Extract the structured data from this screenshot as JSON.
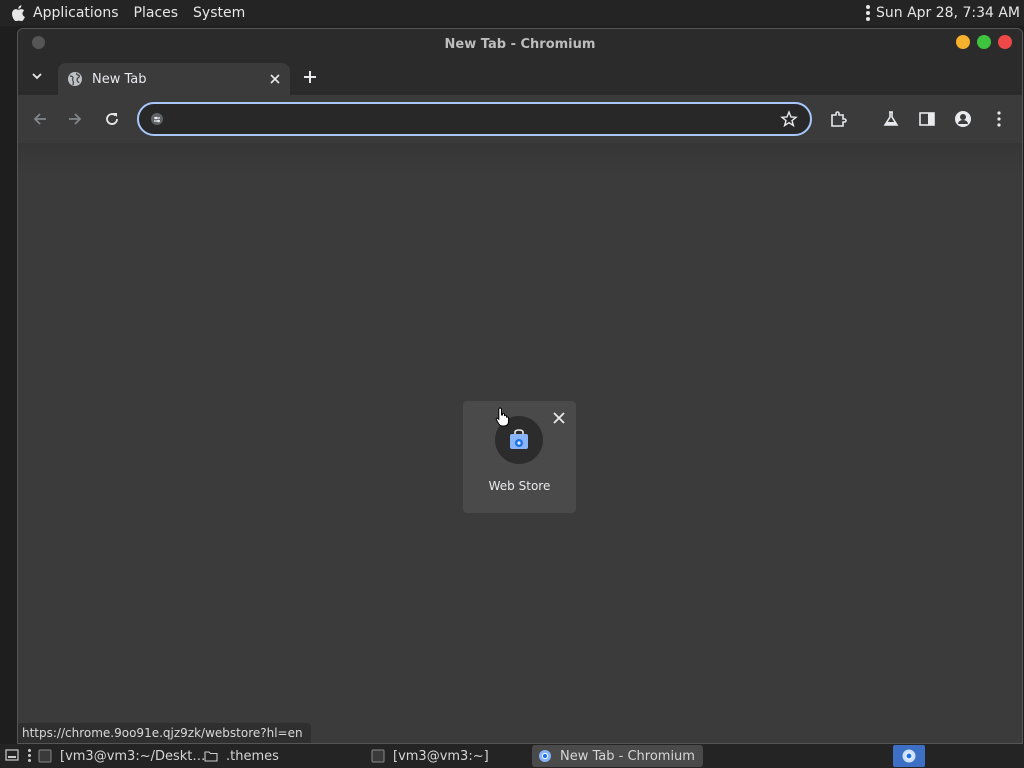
{
  "top_panel": {
    "menus": [
      "Applications",
      "Places",
      "System"
    ],
    "clock": "Sun Apr 28,  7:34 AM"
  },
  "window": {
    "title": "New Tab - Chromium",
    "buttons_colors": {
      "minimize": "#f6b12d",
      "maximize": "#3ec33e",
      "close": "#ee4848"
    }
  },
  "tab": {
    "title": "New Tab"
  },
  "omnibox": {
    "value": "",
    "placeholder": ""
  },
  "shortcut": {
    "label": "Web Store"
  },
  "status_url": "https://chrome.9oo91e.qjz9zk/webstore?hl=en",
  "taskbar": {
    "tasks": [
      {
        "label": "[vm3@vm3:~/Deskt…",
        "icon": "terminal-icon"
      },
      {
        "label": ".themes",
        "icon": "folder-icon"
      },
      {
        "label": "[vm3@vm3:~]",
        "icon": "terminal-icon"
      },
      {
        "label": "New Tab - Chromium",
        "icon": "chromium-icon"
      }
    ]
  },
  "colors": {
    "accent": "#a8c7fa",
    "panel": "#242424",
    "content_bg": "#3b3b3b"
  }
}
